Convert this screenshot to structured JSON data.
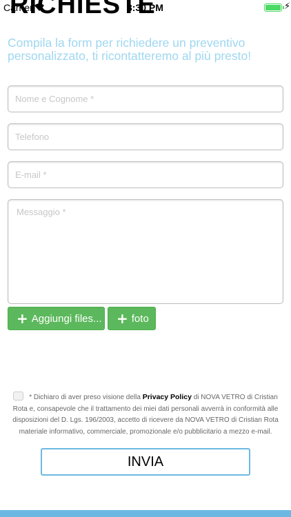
{
  "status_bar": {
    "carrier": "Carrier",
    "time": "3:30 PM",
    "wifi_icon": "wifi-icon",
    "battery_icon": "battery-icon",
    "charging_icon": "charging-bolt-icon",
    "battery_level": 1.0,
    "battery_color": "#4cd964"
  },
  "page": {
    "title": "RICHIESTE",
    "intro": "Compila la form per richiedere un preventivo personalizzato, ti ricontatteremo al più presto!",
    "accent_color": "#6db8e2"
  },
  "form": {
    "name_placeholder": "Nome e Cognome *",
    "phone_placeholder": "Telefono",
    "email_placeholder": "E-mail *",
    "message_placeholder": "Messaggio *",
    "add_files_label": "Aggiungi files...",
    "photo_label": "foto",
    "plus_glyph": "+",
    "plus_icon": "plus-icon",
    "button_color": "#5cb85c"
  },
  "consent": {
    "checked": false,
    "text_before": "* Dichiaro di aver preso visione della ",
    "policy_link": "Privacy Policy",
    "text_after": " di NOVA VETRO di Cristian Rota e, consapevole che il trattamento dei miei dati personali avverrà in conformità alle disposizioni del D. Lgs. 196/2003, accetto di ricevere da NOVA VETRO di Cristian Rota materiale informativo, commerciale, promozionale e/o pubblicitario a mezzo e-mail."
  },
  "submit": {
    "label": "INVIA"
  }
}
